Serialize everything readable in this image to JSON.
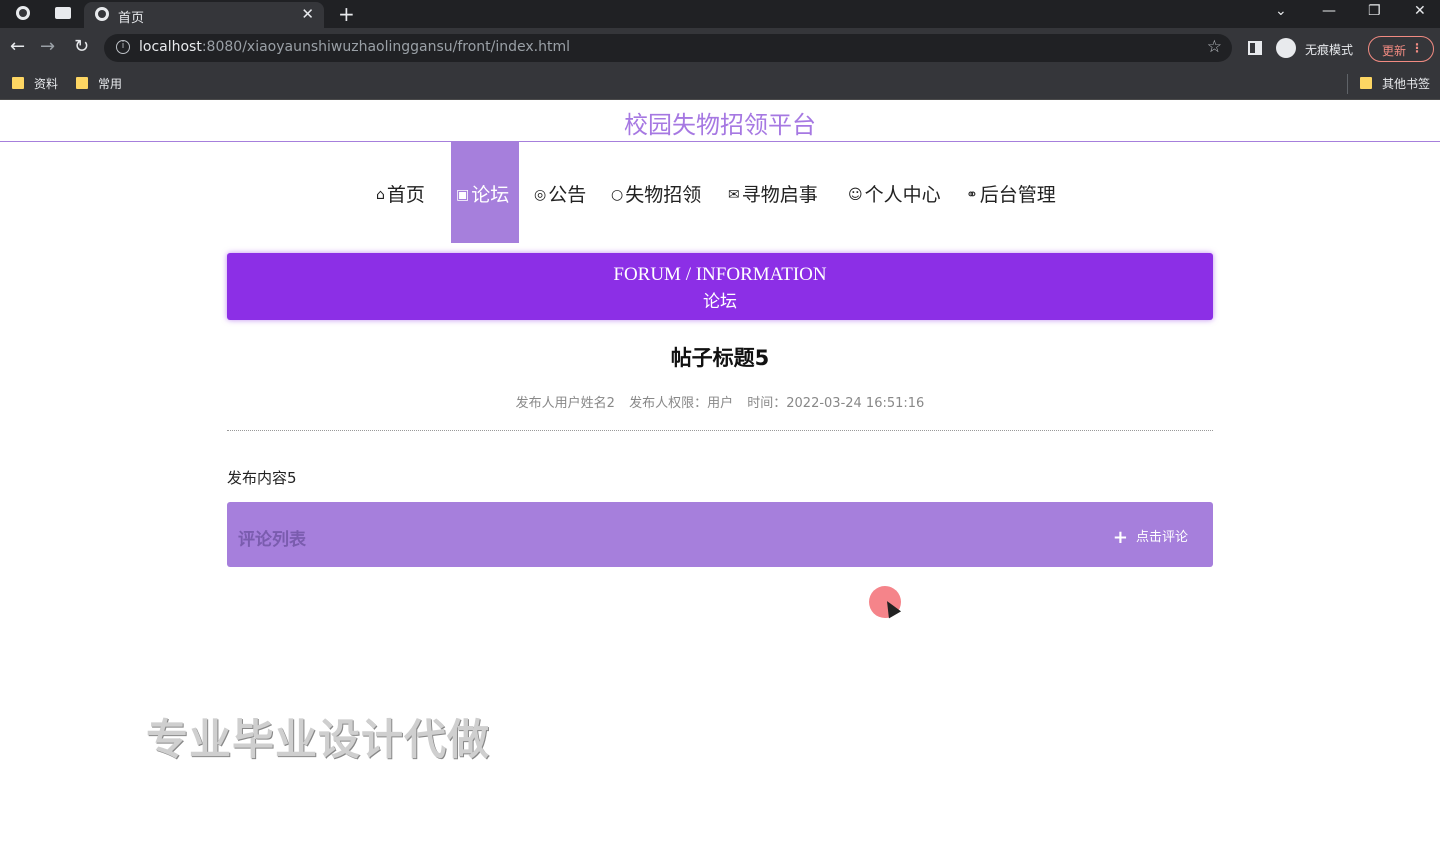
{
  "browser": {
    "tab_title": "首页",
    "url_host": "localhost",
    "url_rest": ":8080/xiaoyaunshiwuzhaolinggansu/front/index.html",
    "incognito_label": "无痕模式",
    "update_label": "更新",
    "bookmarks": [
      "资料",
      "常用"
    ],
    "other_bookmarks": "其他书签"
  },
  "site": {
    "title": "校园失物招领平台"
  },
  "nav": [
    {
      "icon": "⌂",
      "label": "首页"
    },
    {
      "icon": "▣",
      "label": "论坛"
    },
    {
      "icon": "◎",
      "label": "公告"
    },
    {
      "icon": "○",
      "label": "失物招领"
    },
    {
      "icon": "✉",
      "label": "寻物启事"
    },
    {
      "icon": "☺",
      "label": "个人中心"
    },
    {
      "icon": "⚭",
      "label": "后台管理"
    }
  ],
  "banner": {
    "en": "FORUM / INFORMATION",
    "cn": "论坛"
  },
  "post": {
    "title": "帖子标题5",
    "author": "发布人用户姓名2",
    "role": "发布人权限：用户",
    "time": "时间：2022-03-24 16:51:16",
    "content": "发布内容5"
  },
  "comments": {
    "title": "评论列表",
    "add_label": "点击评论"
  },
  "watermark": "专业毕业设计代做",
  "colors": {
    "accent": "#a67fdc",
    "banner": "#8c2fe6"
  }
}
